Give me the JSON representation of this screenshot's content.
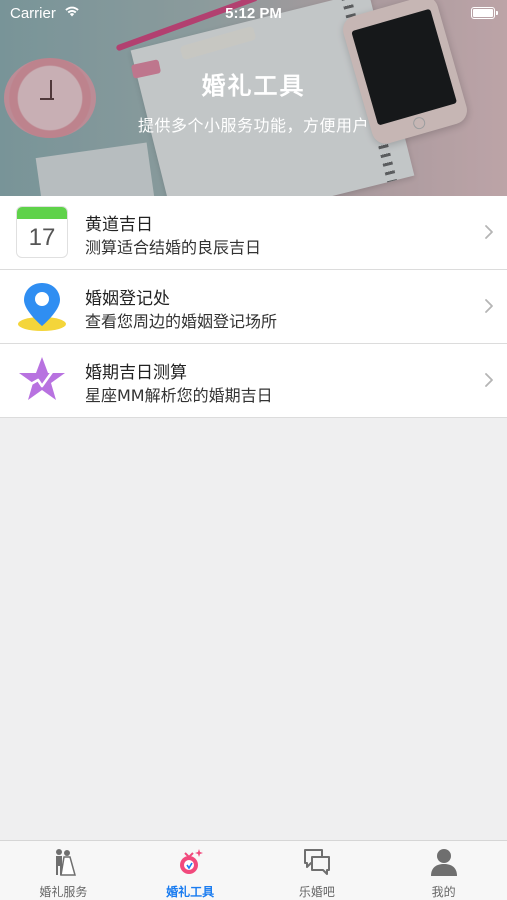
{
  "status_bar": {
    "carrier": "Carrier",
    "time": "5:12 PM"
  },
  "header": {
    "title": "婚礼工具",
    "subtitle": "提供多个小服务功能，方便用户"
  },
  "tools": [
    {
      "title": "黄道吉日",
      "subtitle": "测算适合结婚的良辰吉日",
      "icon": "calendar-icon",
      "icon_text": "17"
    },
    {
      "title": "婚姻登记处",
      "subtitle": "查看您周边的婚姻登记场所",
      "icon": "location-pin-icon"
    },
    {
      "title": "婚期吉日测算",
      "subtitle": "星座MM解析您的婚期吉日",
      "icon": "star-icon"
    }
  ],
  "tab_bar": {
    "active_color": "#1a7cf0",
    "tabs": [
      {
        "label": "婚礼服务",
        "icon": "couple-icon",
        "active": false
      },
      {
        "label": "婚礼工具",
        "icon": "ring-icon",
        "active": true
      },
      {
        "label": "乐婚吧",
        "icon": "chat-bubbles-icon",
        "active": false
      },
      {
        "label": "我的",
        "icon": "user-icon",
        "active": false
      }
    ]
  }
}
